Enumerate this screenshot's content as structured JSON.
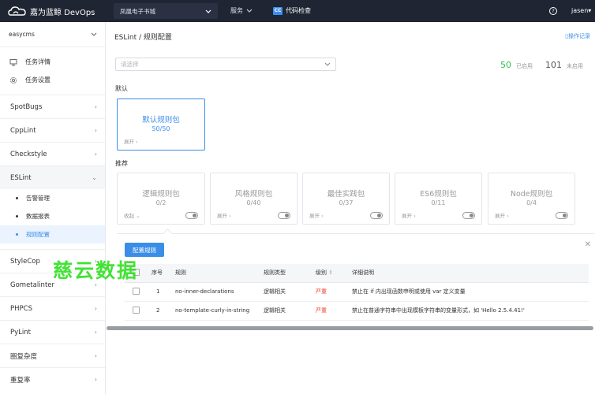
{
  "topbar": {
    "logo_text": "嘉为蓝鲸 DevOps",
    "project": "凤凰电子书城",
    "service_label": "服务",
    "tool_label": "代码检查",
    "tool_badge": "CC",
    "help_icon": "?",
    "user": "jasen"
  },
  "sidebar": {
    "project_select": "easycms",
    "items": [
      {
        "label": "任务详情",
        "icon": "monitor-icon"
      },
      {
        "label": "任务设置",
        "icon": "gear-icon"
      }
    ],
    "groups": [
      {
        "label": "SpotBugs"
      },
      {
        "label": "CppLint"
      },
      {
        "label": "Checkstyle"
      },
      {
        "label": "ESLint",
        "children": [
          "告警管理",
          "数据报表",
          "规则配置"
        ]
      },
      {
        "label": "StyleCop"
      },
      {
        "label": "Gometalinter"
      },
      {
        "label": "PHPCS"
      },
      {
        "label": "PyLint"
      },
      {
        "label": "圈复杂度"
      },
      {
        "label": "重复率"
      }
    ]
  },
  "main": {
    "breadcrumb": "ESLint / 规则配置",
    "op_log": "操作记录",
    "select_placeholder": "请选择",
    "enabled": {
      "count": "50",
      "label": "已启用"
    },
    "disabled": {
      "count": "101",
      "label": "未启用"
    },
    "default_section": "默认",
    "recommend_section": "推荐",
    "default_pack": {
      "name": "默认规则包",
      "count": "50/50",
      "expand": "展开 "
    },
    "packs": [
      {
        "name": "逻辑规则包",
        "count": "0/2",
        "expand": "收起"
      },
      {
        "name": "风格规则包",
        "count": "0/40",
        "expand": "展开 "
      },
      {
        "name": "最佳实践包",
        "count": "0/37",
        "expand": "展开 "
      },
      {
        "name": "ES6规则包",
        "count": "0/11",
        "expand": "展开 "
      },
      {
        "name": "Node规则包",
        "count": "0/4",
        "expand": "展开 "
      }
    ],
    "config_button": "配置规则",
    "table": {
      "headers": [
        "序号",
        "规则",
        "规则类型",
        "级别",
        "详细说明"
      ],
      "rows": [
        {
          "no": "1",
          "rule": "no-inner-declarations",
          "type": "逻辑相关",
          "level": "严重",
          "desc": "禁止在 if 内出现函数申明或使用 var 定义变量"
        },
        {
          "no": "2",
          "rule": "no-template-curly-in-string",
          "type": "逻辑相关",
          "level": "严重",
          "desc": "禁止在普通字符串中出现模板字符串的变量形式，如 'Hello 2.5.4.41!'"
        }
      ]
    }
  },
  "watermark": "慈云数据",
  "colors": {
    "accent": "#3a8ee6",
    "enabled_num": "#2fbf4a",
    "severe": "#e8402c",
    "topbar": "#1f2532"
  }
}
